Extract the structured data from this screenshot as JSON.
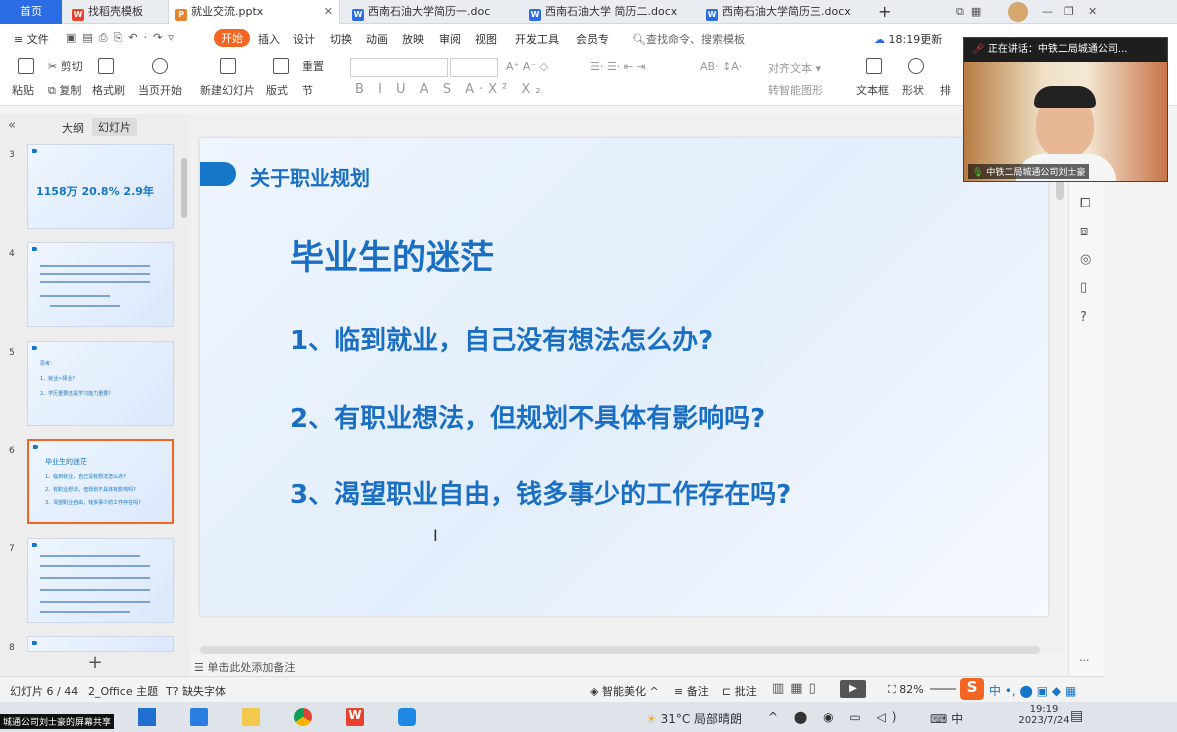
{
  "tabs": {
    "home": "首页",
    "t1": "找稻壳模板",
    "t2": "就业交流.pptx",
    "t3": "西南石油大学简历一.doc",
    "t4": "西南石油大学 简历二.docx",
    "t5": "西南石油大学简历三.docx",
    "new_tab": "+"
  },
  "menu": {
    "file": "文件",
    "start": "开始",
    "insert": "插入",
    "design": "设计",
    "switch": "切换",
    "animation": "动画",
    "slideshow": "放映",
    "review": "审阅",
    "view": "视图",
    "devtools": "开发工具",
    "member": "会员专",
    "search": "查找命令、搜索模板",
    "update": "18:19更新"
  },
  "ribbon": {
    "cut": "剪切",
    "paste": "粘贴",
    "copy": "复制",
    "format_painter": "格式刷",
    "play_current": "当页开始",
    "new_slide": "新建幻灯片",
    "layout": "版式",
    "section": "节",
    "reset": "重置",
    "align_text": "对齐文本",
    "smartart": "转智能图形",
    "textbox": "文本框",
    "shape": "形状",
    "arrange": "排"
  },
  "sidebar": {
    "outline": "大纲",
    "slides": "幻灯片"
  },
  "thumbs": {
    "n3": "3",
    "t3": "1158万   20.8%   2.9年",
    "n4": "4",
    "n5": "5",
    "t5a": "思考：",
    "t5b": "1、就业>择业?",
    "t5c": "2、学历重要还是学习能力重要?",
    "n6": "6",
    "t6a": "毕业生的迷茫",
    "t6b": "1、临到就业，自己没有想法怎么办?",
    "t6c": "2、有职业想法，但规划不具体有影响吗?",
    "t6d": "3、渴望职业自由，钱多事少的工作存在吗?",
    "n7": "7",
    "n8": "8",
    "add": "+"
  },
  "slide": {
    "header": "关于职业规划",
    "title": "毕业生的迷茫",
    "q1": "1、临到就业，自己没有想法怎么办?",
    "q2": "2、有职业想法，但规划不具体有影响吗?",
    "q3": "3、渴望职业自由，钱多事少的工作存在吗?",
    "notes": "单击此处添加备注"
  },
  "status": {
    "slide_pos": "幻灯片 6 / 44",
    "theme": "2_Office 主题",
    "missing_font": "缺失字体",
    "beautify": "智能美化",
    "notes": "备注",
    "comment": "批注",
    "zoom": "82%"
  },
  "video": {
    "speaking": "正在讲话：中铁二局城通公司...",
    "name": "中铁二局城通公司刘士豪"
  },
  "taskbar": {
    "share": "城通公司刘士豪的屏幕共享",
    "weather": "31°C 局部晴朗",
    "time": "19:19",
    "date": "2023/7/24",
    "ime": "中"
  }
}
